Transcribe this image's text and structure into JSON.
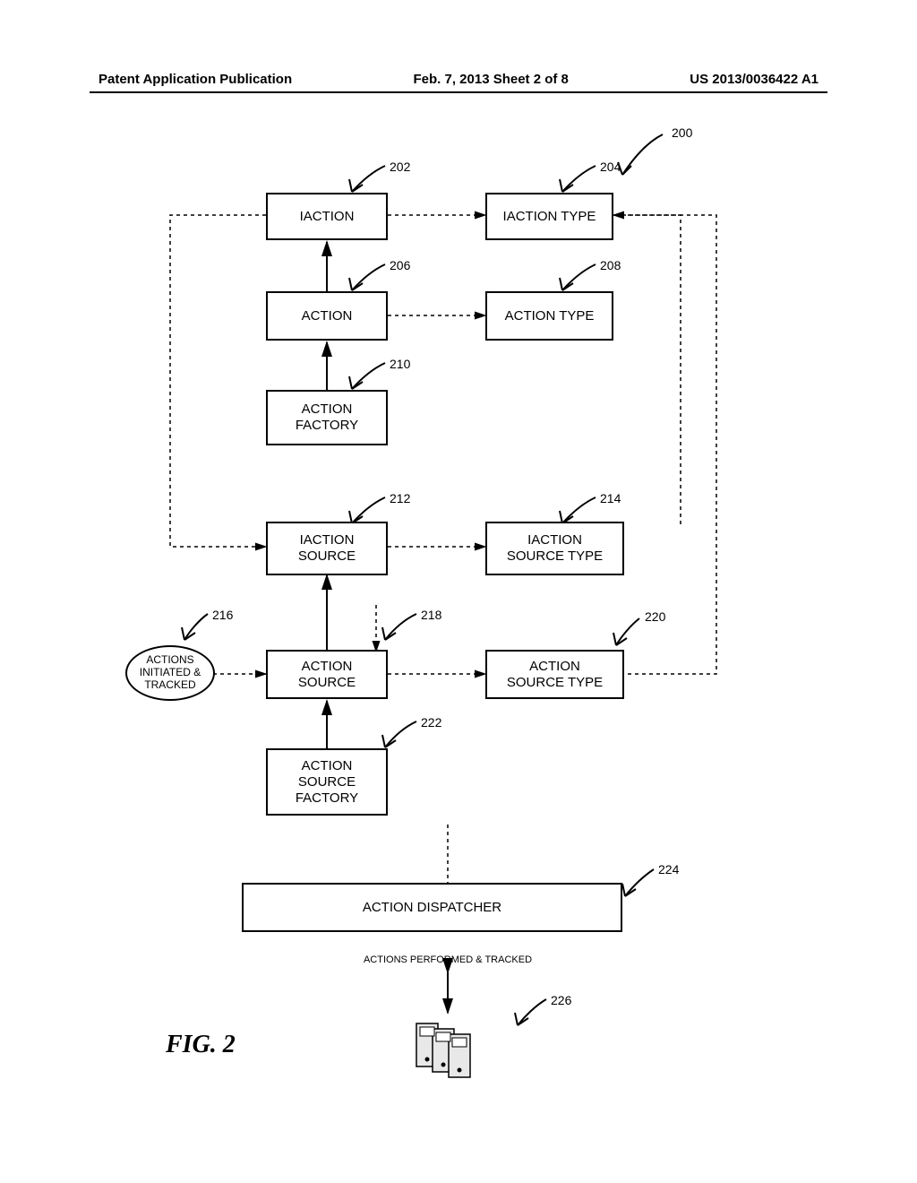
{
  "header": {
    "left": "Patent Application Publication",
    "mid": "Feb. 7, 2013  Sheet 2 of 8",
    "right": "US 2013/0036422 A1"
  },
  "boxes": {
    "b202": "IACTION",
    "b204": "IACTION TYPE",
    "b206": "ACTION",
    "b208": "ACTION TYPE",
    "b210": "ACTION\nFACTORY",
    "b212": "IACTION\nSOURCE",
    "b214": "IACTION\nSOURCE TYPE",
    "b218": "ACTION\nSOURCE",
    "b220": "ACTION\nSOURCE TYPE",
    "b222": "ACTION\nSOURCE\nFACTORY",
    "b224": "ACTION DISPATCHER"
  },
  "bubble216": "ACTIONS\nINITIATED &\nTRACKED",
  "refs": {
    "r200": "200",
    "r202": "202",
    "r204": "204",
    "r206": "206",
    "r208": "208",
    "r210": "210",
    "r212": "212",
    "r214": "214",
    "r216": "216",
    "r218": "218",
    "r220": "220",
    "r222": "222",
    "r224": "224",
    "r226": "226"
  },
  "annotations": {
    "dispatch_note": "ACTIONS PERFORMED & TRACKED"
  },
  "figure_label": "FIG. 2"
}
